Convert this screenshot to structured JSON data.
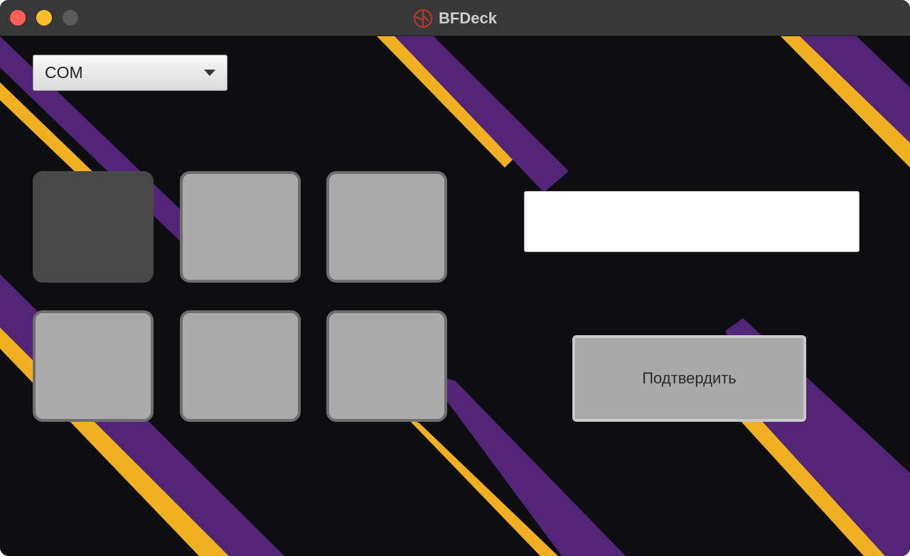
{
  "window": {
    "title": "BFDeck",
    "app_icon": "bfdeck-logo-icon",
    "controls": [
      "close-icon",
      "minimize-icon",
      "maximize-icon"
    ]
  },
  "port_select": {
    "value": "COM",
    "icon": "chevron-down-icon"
  },
  "keypad": {
    "rows": 2,
    "columns": 3,
    "active_index": 0
  },
  "command_input": {
    "value": ""
  },
  "confirm_button": {
    "label": "Подтвердить"
  },
  "colors": {
    "background": "#0e0e10",
    "stripe_purple": "#522579",
    "stripe_yellow": "#f0b021",
    "key_idle": "#aaaaaa",
    "key_active": "#484848"
  }
}
